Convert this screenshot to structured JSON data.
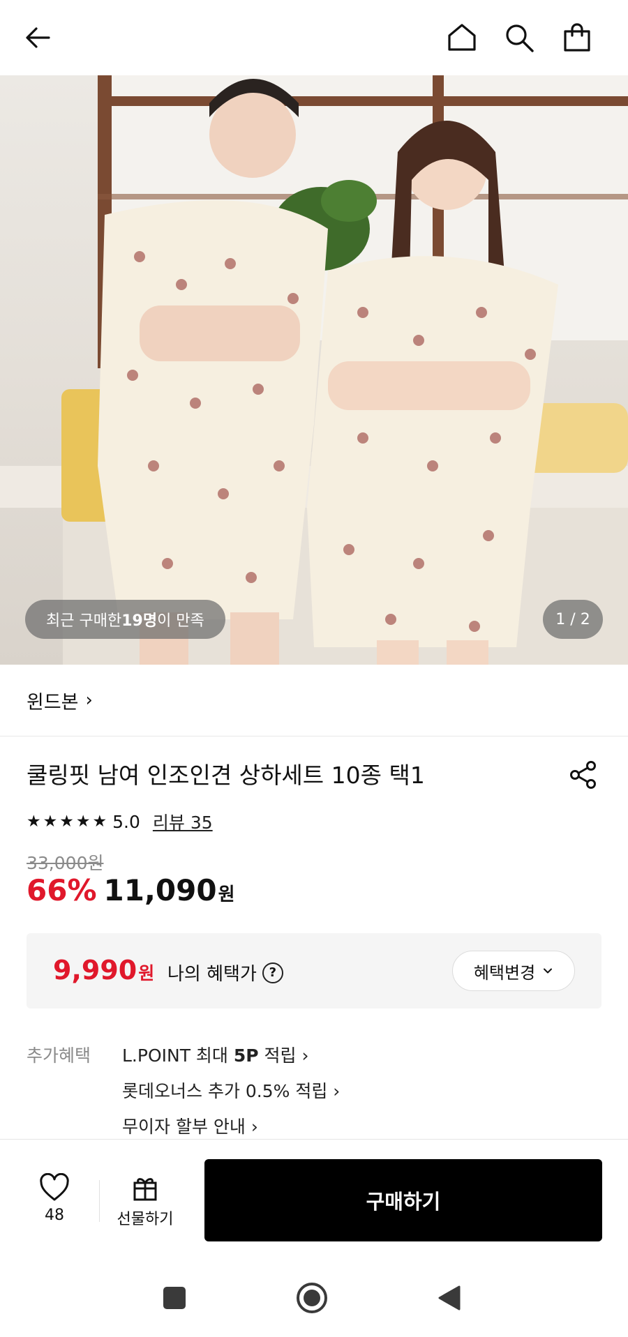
{
  "header": {
    "back_icon": "arrow-left-icon",
    "home_icon": "home-icon",
    "search_icon": "search-icon",
    "cart_icon": "shopping-bag-icon"
  },
  "hero": {
    "buyers_prefix": "최근 구매한 ",
    "buyers_count": "19명",
    "buyers_suffix": "이 만족",
    "counter": "1 / 2"
  },
  "brand": {
    "name": "윈드본",
    "chevron": "›"
  },
  "product": {
    "title": "쿨링핏 남여 인조인견 상하세트 10종 택1",
    "share_icon": "share-icon",
    "stars": [
      "★",
      "★",
      "★",
      "★",
      "★"
    ],
    "rating": "5.0",
    "review_link": "리뷰 35",
    "original_price": "33,000원",
    "discount": "66%",
    "sale_price": "11,090",
    "currency": "원"
  },
  "benefit": {
    "price": "9,990",
    "currency": "원",
    "label": "나의 혜택가",
    "help": "?",
    "change_button": "혜택변경",
    "change_chevron": "⌄"
  },
  "extra_benefits": {
    "label": "추가혜택",
    "items": [
      {
        "prefix": "L.POINT 최대 ",
        "bold": "5P",
        "suffix": " 적립 ›"
      },
      {
        "prefix": "롯데오너스 추가 0.5% 적립 ›",
        "bold": "",
        "suffix": ""
      },
      {
        "prefix": "무이자 할부 안내 ›",
        "bold": "",
        "suffix": ""
      }
    ]
  },
  "action_bar": {
    "wish_count": "48",
    "gift_label": "선물하기",
    "buy_label": "구매하기"
  },
  "colors": {
    "accent_red": "#e0182b",
    "buy_button": "#000000"
  }
}
